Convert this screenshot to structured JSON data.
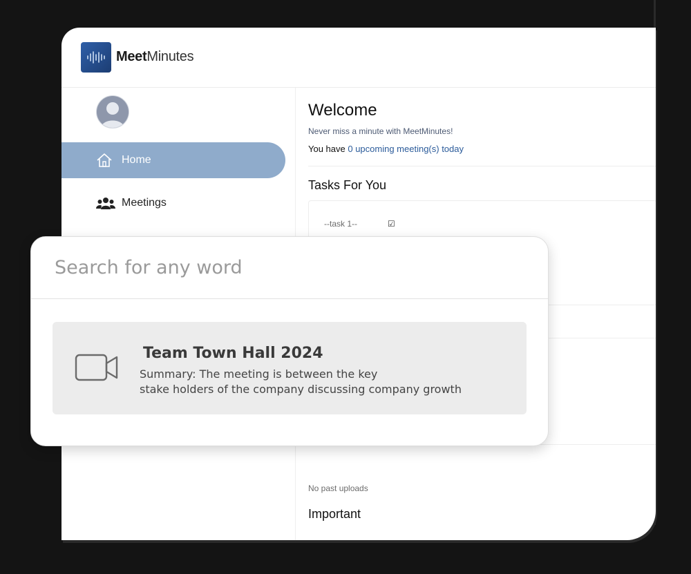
{
  "app": {
    "brand_part1": "Meet",
    "brand_part2": "Minutes"
  },
  "sidebar": {
    "items": [
      {
        "label": "Home",
        "icon": "home-icon",
        "active": true
      },
      {
        "label": "Meetings",
        "icon": "people-group-icon",
        "active": false
      }
    ]
  },
  "main": {
    "welcome_title": "Welcome",
    "welcome_subtitle": "Never miss a minute with MeetMinutes!",
    "upcoming_prefix": "You have ",
    "upcoming_link": "0 upcoming meeting(s) today",
    "tasks_title": "Tasks For You",
    "task_1_label": "--task 1--",
    "task_1_check": "☑",
    "past_uploads": "No past uploads",
    "important_title": "Important"
  },
  "search": {
    "placeholder": "Search for any word",
    "value": "",
    "result": {
      "icon": "video-camera-icon",
      "title": "Team Town Hall 2024",
      "summary_line1": "Summary: The meeting is between the key",
      "summary_line2": "stake holders of the company discussing company growth"
    }
  },
  "colors": {
    "active_nav": "#8fabcb",
    "link": "#2b5b9a",
    "logo": "#2f5fa8",
    "background": "#141414"
  }
}
